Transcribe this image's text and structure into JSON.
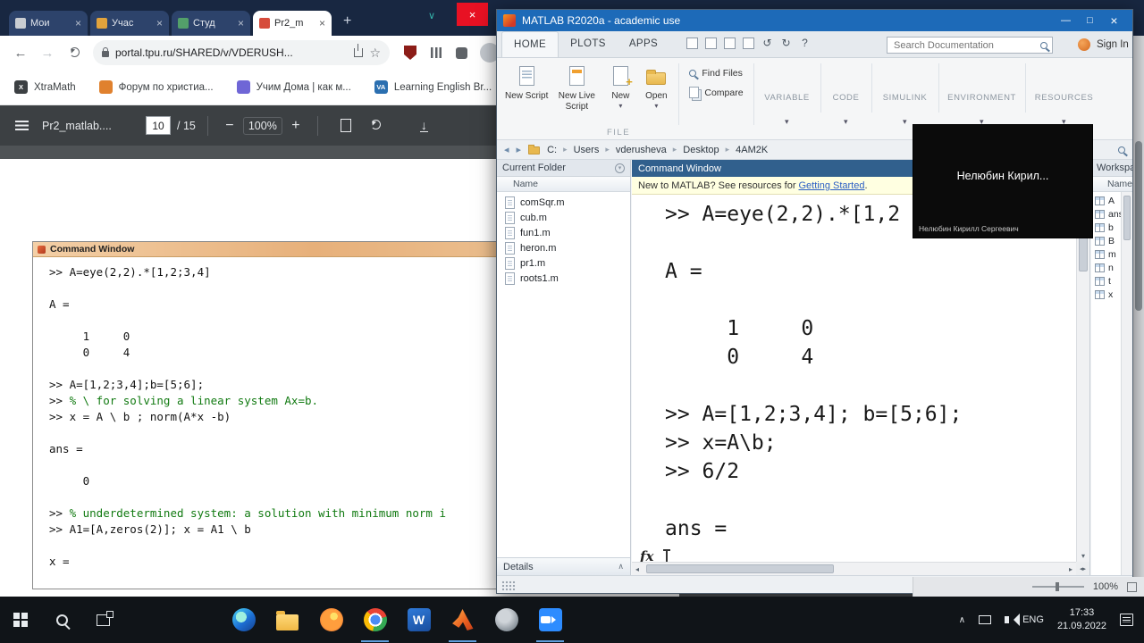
{
  "icons": {
    "close": "×",
    "new_tab": "+",
    "back": "←",
    "forward": "→",
    "star": "☆",
    "minus": "−",
    "plus": "+",
    "download": "↓",
    "caret": "▾",
    "crumb": "▸",
    "minimize": "—",
    "maximize": "□",
    "chevron_up": "∧",
    "chevron_down": "∨",
    "up": "▴",
    "down": "▾",
    "left": "◂",
    "right": "▸",
    "undo": "↺",
    "redo": "↻",
    "help": "?",
    "resize": "◂▸"
  },
  "chrome": {
    "tabs": [
      {
        "label": "Мои",
        "favicon": "#c9cdd2",
        "active": false
      },
      {
        "label": "Учас",
        "favicon": "#e2a33c",
        "active": false
      },
      {
        "label": "Студ",
        "favicon": "#53a06a",
        "active": false
      },
      {
        "label": "Pr2_m",
        "favicon": "#d64b3a",
        "active": true
      }
    ],
    "address_url": "portal.tpu.ru/SHARED/v/VDERUSH...",
    "bookmarks": [
      {
        "label": "XtraMath",
        "badge": "X",
        "color": "#3c4043"
      },
      {
        "label": "Форум по христиа...",
        "badge": "",
        "color": "#e0812e"
      },
      {
        "label": "Учим Дома | как м...",
        "badge": "",
        "color": "#6f66d6"
      },
      {
        "label": "Learning English Br...",
        "badge": "VA",
        "color": "#2b6fb0"
      }
    ],
    "pdf": {
      "doc_title": "Pr2_matlab....",
      "page_current": "10",
      "page_total_label": "/ 15",
      "zoom": "100%"
    }
  },
  "pdf_shot": {
    "window_title": "Command Window",
    "lines": [
      {
        "t": ">> A=eye(2,2).*[1,2;3,4]"
      },
      {
        "t": ""
      },
      {
        "t": "A ="
      },
      {
        "t": ""
      },
      {
        "t": "     1     0"
      },
      {
        "t": "     0     4"
      },
      {
        "t": ""
      },
      {
        "t": ">> A=[1,2;3,4];b=[5;6];"
      },
      {
        "t": ">> % \\ for solving a linear system Ax=b.",
        "g": true
      },
      {
        "t": ">> x = A \\ b ; norm(A*x -b)"
      },
      {
        "t": ""
      },
      {
        "t": "ans ="
      },
      {
        "t": ""
      },
      {
        "t": "     0"
      },
      {
        "t": ""
      },
      {
        "t": ">> % underdetermined system: a solution with minimum norm i",
        "g": true
      },
      {
        "t": ">> A1=[A,zeros(2)]; x = A1 \\ b"
      },
      {
        "t": ""
      },
      {
        "t": "x ="
      }
    ]
  },
  "matlab": {
    "window_title": "MATLAB R2020a - academic use",
    "tabs": [
      {
        "label": "HOME",
        "active": true
      },
      {
        "label": "PLOTS",
        "active": false
      },
      {
        "label": "APPS",
        "active": false
      }
    ],
    "quick_icons": [
      "save",
      "cut",
      "copy",
      "paste",
      "undo",
      "redo",
      "help"
    ],
    "search_placeholder": "Search Documentation",
    "sign_in": "Sign In",
    "ribbon": {
      "buttons": [
        {
          "label": "New Script",
          "icon": "new-script",
          "caret": false
        },
        {
          "label": "New Live Script",
          "icon": "new-live-script",
          "caret": false
        },
        {
          "label": "New",
          "icon": "new",
          "caret": true
        },
        {
          "label": "Open",
          "icon": "open",
          "caret": true
        }
      ],
      "find_files": "Find Files",
      "compare": "Compare",
      "group_label": "FILE",
      "collapsed": [
        "VARIABLE",
        "CODE",
        "SIMULINK",
        "ENVIRONMENT",
        "RESOURCES"
      ]
    },
    "breadcrumb": [
      "C:",
      "Users",
      "vderusheva",
      "Desktop",
      "4AM2K"
    ],
    "current_folder": {
      "title": "Current Folder",
      "column": "Name",
      "files": [
        "comSqr.m",
        "cub.m",
        "fun1.m",
        "heron.m",
        "pr1.m",
        "roots1.m"
      ],
      "details": "Details"
    },
    "command_window": {
      "title": "Command Window",
      "banner_text": "New to MATLAB? See resources for",
      "banner_link": "Getting Started",
      "banner_period": ".",
      "lines": [
        ">> A=eye(2,2).*[1,2",
        "",
        "A =",
        "",
        "     1     0",
        "     0     4",
        "",
        ">> A=[1,2;3,4]; b=[5;6];",
        ">> x=A\\b;",
        ">> 6/2",
        "",
        "ans ="
      ],
      "prompt": "fx"
    },
    "workspace": {
      "title": "Workspace",
      "column": "Name",
      "variables": [
        "A",
        "ans",
        "b",
        "B",
        "m",
        "n",
        "t",
        "x"
      ]
    }
  },
  "overlay": {
    "name_short": "Нелюбин Кирил...",
    "name_full": "Нелюбин Кирилл Сергеевич"
  },
  "bgapp": {
    "zoom": "100%"
  },
  "taskbar": {
    "apps": [
      "edge",
      "explorer",
      "firefox",
      "chrome",
      "word",
      "matlab",
      "gimp",
      "zoom"
    ],
    "running": [
      "chrome",
      "matlab",
      "zoom"
    ],
    "badges": {
      "word": "W"
    },
    "lang": "ENG",
    "time": "17:33",
    "date": "21.09.2022"
  }
}
